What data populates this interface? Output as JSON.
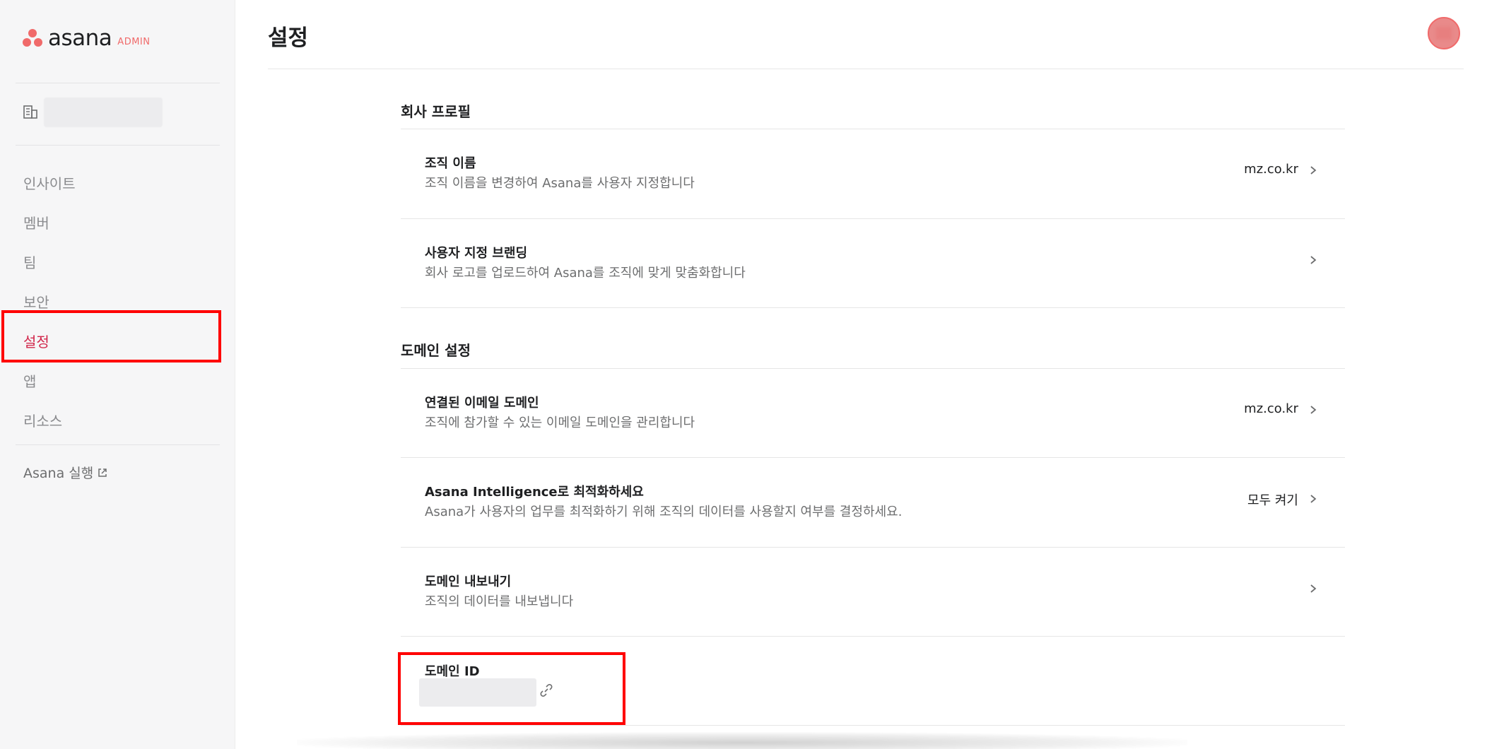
{
  "app": {
    "logo_word": "asana",
    "logo_admin": "ADMIN",
    "page_title": "설정",
    "accent_color": "#f06a6a",
    "active_color": "#d1274b"
  },
  "sidebar": {
    "items": [
      {
        "label": "인사이트",
        "active": false
      },
      {
        "label": "멤버",
        "active": false
      },
      {
        "label": "팀",
        "active": false
      },
      {
        "label": "보안",
        "active": false
      },
      {
        "label": "설정",
        "active": true
      },
      {
        "label": "앱",
        "active": false
      },
      {
        "label": "리소스",
        "active": false
      }
    ],
    "run_link": "Asana 실행"
  },
  "sections": {
    "company_profile": {
      "title": "회사 프로필",
      "rows": [
        {
          "title": "조직 이름",
          "desc": "조직 이름을 변경하여 Asana를 사용자 지정합니다",
          "value": "mz.co.kr"
        },
        {
          "title": "사용자 지정 브랜딩",
          "desc": "회사 로고를 업로드하여 Asana를 조직에 맞게 맞춤화합니다",
          "value": ""
        }
      ]
    },
    "domain_settings": {
      "title": "도메인 설정",
      "rows": [
        {
          "title": "연결된 이메일 도메인",
          "desc": "조직에 참가할 수 있는 이메일 도메인을 관리합니다",
          "value": "mz.co.kr"
        },
        {
          "title": "Asana Intelligence로 최적화하세요",
          "desc": "Asana가 사용자의 업무를 최적화하기 위해 조직의 데이터를 사용할지 여부를 결정하세요.",
          "value": "모두 켜기"
        },
        {
          "title": "도메인 내보내기",
          "desc": "조직의 데이터를 내보냅니다",
          "value": ""
        }
      ],
      "domain_id_title": "도메인 ID"
    }
  }
}
